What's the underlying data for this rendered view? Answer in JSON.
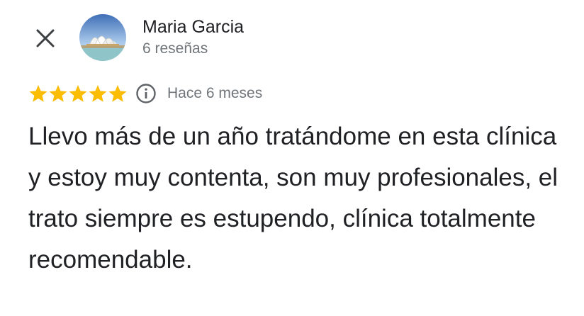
{
  "reviewer": {
    "name": "Maria Garcia",
    "reviews_count": "6 reseñas",
    "avatar_icon": "sydney-opera-house-avatar"
  },
  "rating": {
    "stars": 5,
    "max_stars": 5,
    "star_color": "#fbbc04",
    "date": "Hace 6 meses"
  },
  "review": {
    "text": "Llevo más de un año tratándome en esta clínica y estoy muy contenta, son muy profesionales, el trato siempre es estupendo, clínica totalmente recomendable."
  },
  "icons": {
    "close": "close-icon",
    "info": "info-icon",
    "star": "star-icon"
  }
}
